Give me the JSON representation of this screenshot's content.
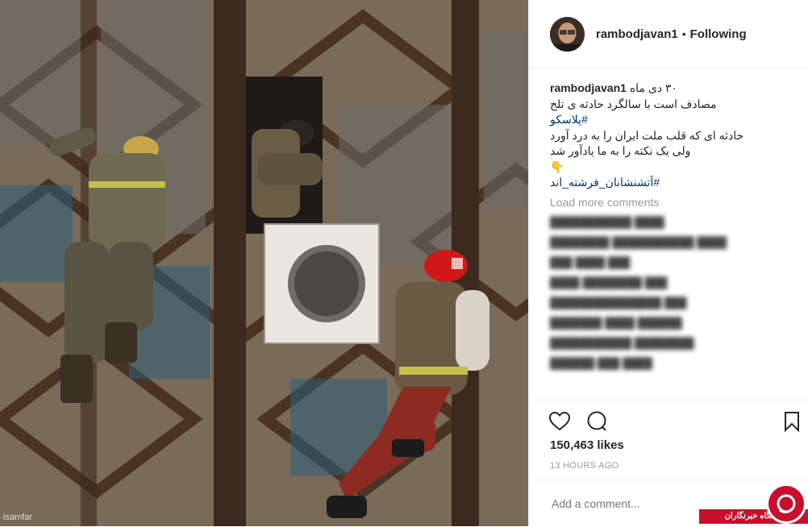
{
  "post": {
    "username": "rambodjavan1",
    "follow_status": "Following",
    "caption_user": "rambodjavan1",
    "caption_date": "۳۰ دی ماه",
    "caption_line1": "مصادف است با سالگرد حادثه ی تلخ",
    "caption_tag1": "#پلاسکو",
    "caption_line2": "حادثه ای که قلب ملت ایران را به درد آورد",
    "caption_line3": "ولی یک نکته را به ما یادآور شد",
    "caption_emoji": "👇",
    "caption_tag2": "#آتشنشانان_فرشته_اند",
    "load_more": "Load more comments",
    "likes": "150,463 likes",
    "time": "13 HOURS AGO",
    "comment_placeholder": "Add a comment...",
    "photo_watermark": "isamfar"
  },
  "badge": {
    "text": "باشگاه خبرنگاران"
  },
  "colors": {
    "accent_blue": "#003569",
    "muted": "#999999",
    "badge_red": "#c8102e"
  },
  "icons": [
    "heart-icon",
    "comment-icon",
    "bookmark-icon",
    "more-icon"
  ]
}
